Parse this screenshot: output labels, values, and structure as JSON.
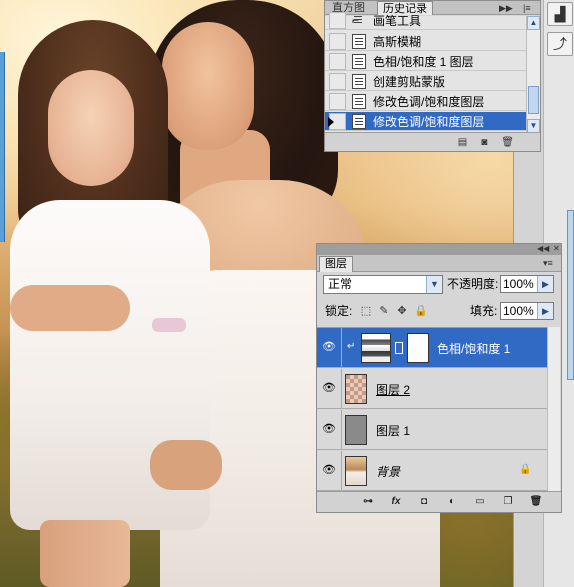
{
  "history_panel": {
    "tabs": [
      "直方图",
      "历史记录"
    ],
    "items": [
      {
        "label": "画笔工具",
        "icon": "brush-icon"
      },
      {
        "label": "高斯模糊",
        "icon": "history-state-icon"
      },
      {
        "label": "色相/饱和度 1 图层",
        "icon": "history-state-icon"
      },
      {
        "label": "创建剪贴蒙版",
        "icon": "history-state-icon"
      },
      {
        "label": "修改色调/饱和度图层",
        "icon": "history-state-icon"
      },
      {
        "label": "修改色调/饱和度图层",
        "icon": "history-state-icon",
        "selected": true
      }
    ]
  },
  "layers_panel": {
    "tab": "图层",
    "blend_mode": "正常",
    "opacity_label": "不透明度:",
    "opacity_value": "100%",
    "lock_label": "锁定:",
    "fill_label": "填充:",
    "fill_value": "100%",
    "layers": [
      {
        "name": "色相/饱和度 1",
        "type": "adjustment",
        "selected": true
      },
      {
        "name": "图层 2",
        "type": "transparent"
      },
      {
        "name": "图层 1",
        "type": "gray"
      },
      {
        "name": "背景",
        "type": "photo",
        "locked": true
      }
    ]
  },
  "colors": {
    "selection": "#316ac5",
    "panel": "#d6d6d6"
  }
}
